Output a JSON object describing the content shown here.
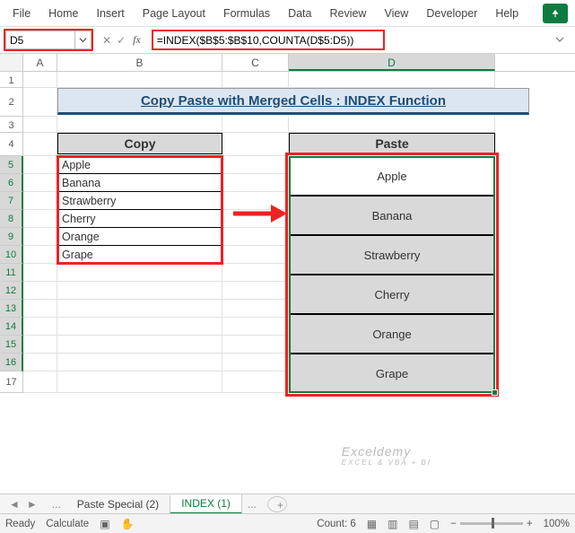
{
  "ribbon": {
    "items": [
      "File",
      "Home",
      "Insert",
      "Page Layout",
      "Formulas",
      "Data",
      "Review",
      "View",
      "Developer",
      "Help"
    ]
  },
  "namebox": {
    "value": "D5"
  },
  "formula": {
    "value": "=INDEX($B$5:$B$10,COUNTA(D$5:D5))"
  },
  "columns": [
    "A",
    "B",
    "C",
    "D"
  ],
  "rows": [
    "1",
    "2",
    "3",
    "4",
    "5",
    "6",
    "7",
    "8",
    "9",
    "10",
    "11",
    "12",
    "13",
    "14",
    "15",
    "16",
    "17"
  ],
  "title": "Copy Paste with Merged Cells : INDEX Function",
  "headers": {
    "copy": "Copy",
    "paste": "Paste"
  },
  "copy_data": [
    "Apple",
    "Banana",
    "Strawberry",
    "Cherry",
    "Orange",
    "Grape"
  ],
  "paste_data": [
    "Apple",
    "Banana",
    "Strawberry",
    "Cherry",
    "Orange",
    "Grape"
  ],
  "tabs": {
    "prev": "Paste Special (2)",
    "active": "INDEX (1)",
    "more": "..."
  },
  "status": {
    "ready": "Ready",
    "calc": "Calculate",
    "count_label": "Count:",
    "count_value": "6",
    "zoom": "100%"
  },
  "watermark": {
    "main": "Exceldemy",
    "sub": "EXCEL & VBA + BI"
  },
  "icons": {
    "share": "share-icon",
    "chev_down": "chevron-down-icon",
    "cancel": "x-icon",
    "enter": "check-icon",
    "fx": "fx-icon",
    "macro": "macro-record-icon",
    "accessibility": "accessibility-icon",
    "display": "display-settings-icon",
    "normal_view": "normal-view-icon",
    "page_layout_view": "page-layout-view-icon",
    "page_break_view": "page-break-view-icon"
  }
}
